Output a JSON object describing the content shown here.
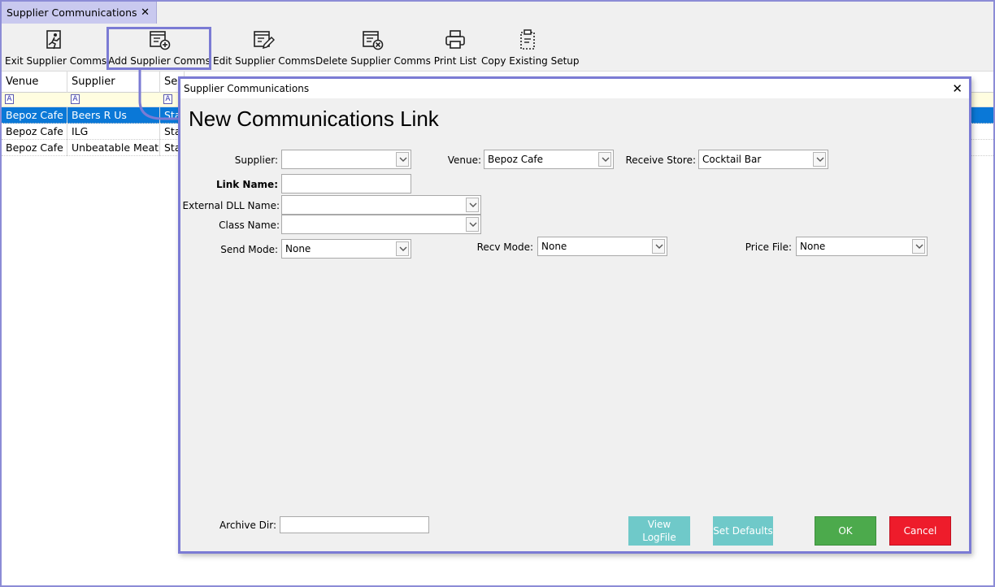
{
  "tab": {
    "title": "Supplier Communications",
    "close": "✕"
  },
  "toolbar": {
    "exit": "Exit Supplier Comms",
    "add": "Add Supplier Comms",
    "edit": "Edit Supplier Comms",
    "delete": "Delete Supplier Comms",
    "print": "Print List",
    "copy": "Copy Existing Setup"
  },
  "grid": {
    "columns": [
      "Venue",
      "Supplier",
      "Se"
    ],
    "filter_chip": "A",
    "rows": [
      {
        "venue": "Bepoz Cafe",
        "supplier": "Beers R Us",
        "col3": "Sta"
      },
      {
        "venue": "Bepoz Cafe",
        "supplier": "ILG",
        "col3": "Sta"
      },
      {
        "venue": "Bepoz Cafe",
        "supplier": "Unbeatable Meat",
        "col3": "Sta"
      }
    ]
  },
  "dialog": {
    "title": "Supplier Communications",
    "close": "✕",
    "heading": "New Communications Link",
    "labels": {
      "supplier": "Supplier:",
      "venue": "Venue:",
      "receive_store": "Receive Store:",
      "link_name": "Link Name:",
      "external_dll": "External DLL Name:",
      "class_name": "Class Name:",
      "send_mode": "Send Mode:",
      "recv_mode": "Recv Mode:",
      "price_file": "Price File:",
      "archive_dir": "Archive Dir:"
    },
    "values": {
      "supplier": "",
      "venue": "Bepoz Cafe",
      "receive_store": "Cocktail Bar",
      "link_name": "",
      "external_dll": "",
      "class_name": "",
      "send_mode": "None",
      "recv_mode": "None",
      "price_file": "None",
      "archive_dir": ""
    },
    "buttons": {
      "view_logfile_1": "View",
      "view_logfile_2": "LogFile",
      "set_defaults": "Set Defaults",
      "ok": "OK",
      "cancel": "Cancel"
    }
  },
  "colors": {
    "accent": "#7b7bd4",
    "selection": "#0a78d7",
    "ok": "#4caa4c",
    "cancel": "#ee1c2b",
    "teal": "#6fc9c9"
  }
}
